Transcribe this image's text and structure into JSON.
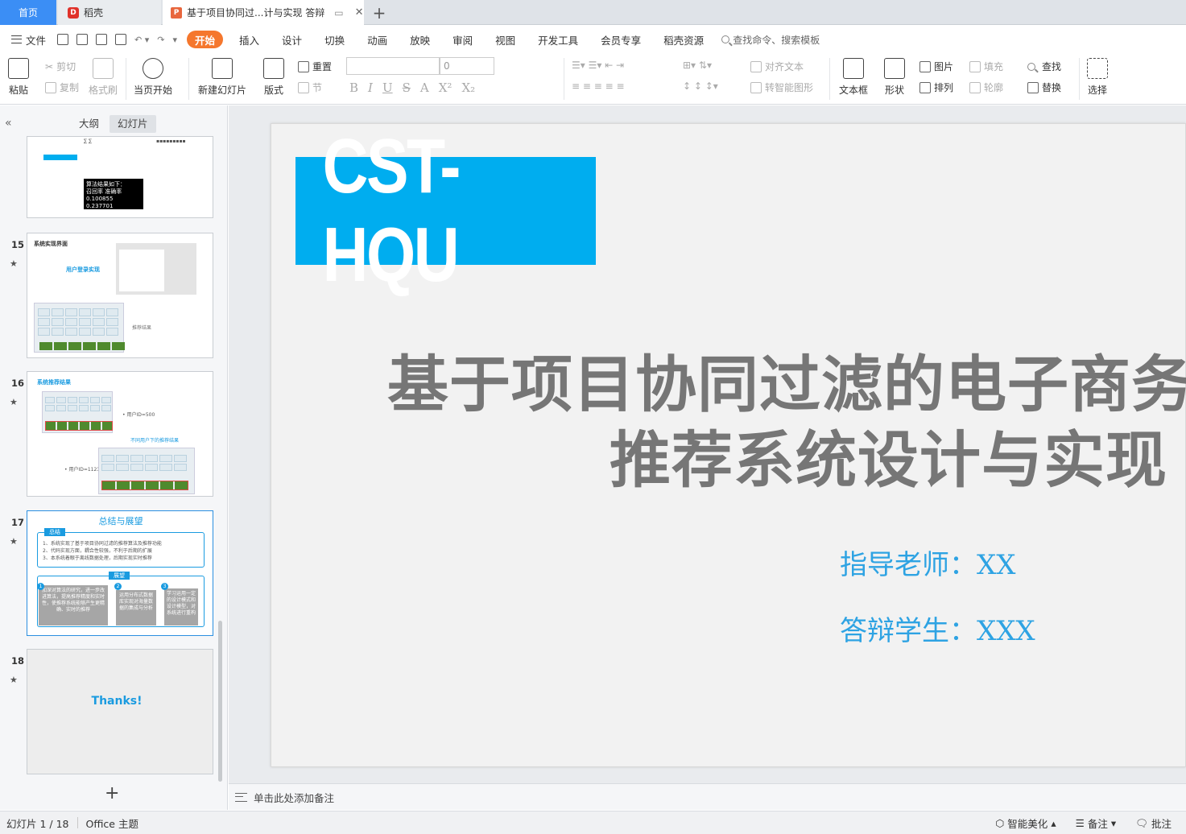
{
  "tabs": {
    "home": "首页",
    "daoke": "稻壳",
    "doc_title": "基于项目协同过...计与实现 答辩",
    "new_tab": "+",
    "close": "✕"
  },
  "menu": {
    "file": "文件",
    "items": [
      "开始",
      "插入",
      "设计",
      "切换",
      "动画",
      "放映",
      "审阅",
      "视图",
      "开发工具",
      "会员专享",
      "稻壳资源"
    ],
    "search_placeholder": "查找命令、搜索模板"
  },
  "ribbon": {
    "paste": "粘贴",
    "cut": "剪切",
    "copy": "复制",
    "format_painter": "格式刷",
    "play_from_current": "当页开始",
    "new_slide": "新建幻灯片",
    "layout": "版式",
    "reset": "重置",
    "section": "节",
    "font_size": "0",
    "align_text": "对齐文本",
    "smart_graphic": "转智能图形",
    "textbox": "文本框",
    "shape": "形状",
    "picture": "图片",
    "arrange": "排列",
    "fill": "填充",
    "outline": "轮廓",
    "find": "查找",
    "replace": "替换",
    "select": "选择"
  },
  "left_panel": {
    "collapse": "«",
    "tab_outline": "大纲",
    "tab_slides": "幻灯片",
    "add": "+",
    "star": "★",
    "thumbs": [
      {
        "num": "",
        "result_heading": "算法结果如下：",
        "result_cols": "召回率      准确率",
        "result_vals": "0.100855    0.237701"
      },
      {
        "num": "15",
        "title": "系统实现界面",
        "subtitle": "用户登录实现",
        "caption": "推荐结果"
      },
      {
        "num": "16",
        "title": "系统推荐结果",
        "caption": "不同用户下的推荐结果",
        "user1": "• 用户ID=500",
        "user2": "• 用户ID=1123"
      },
      {
        "num": "17",
        "title": "总结与展望",
        "section1": "总结",
        "lines": [
          "1、系统实现了基于项目协同过滤的推荐算法及推荐功能",
          "2、代码实现方面，耦合性较强，不利于后期的扩展",
          "3、本系统着眼于离线数据处理，后期实现实时推荐"
        ],
        "section2": "展望",
        "cards": [
          "加深对算法的研究，进一步改进算法，提高推荐精度和实时性，使推荐系统能够产生更精确、实时的推荐",
          "运用分布式数据库实现对海量数据的集成与分析",
          "学习运用一定的设计模式和设计模型，对系统进行重构"
        ]
      },
      {
        "num": "18",
        "title": "Thanks!"
      }
    ]
  },
  "slide": {
    "logo": "CST-HQU",
    "title_line1": "基于项目协同过滤的电子商务",
    "title_line2": "推荐系统设计与实现",
    "advisor": "指导老师：XX",
    "student": "答辩学生：XXX"
  },
  "notes": {
    "placeholder": "单击此处添加备注"
  },
  "status": {
    "slide_indicator": "幻灯片 1 / 18",
    "theme": "Office 主题",
    "beautify": "智能美化",
    "notes": "备注",
    "comments": "批注"
  },
  "colors": {
    "accent_orange": "#f5772d",
    "logo_blue": "#00adef",
    "title_gray": "#767676",
    "info_blue": "#2ea3e3",
    "home_tab": "#3b8ef5"
  }
}
